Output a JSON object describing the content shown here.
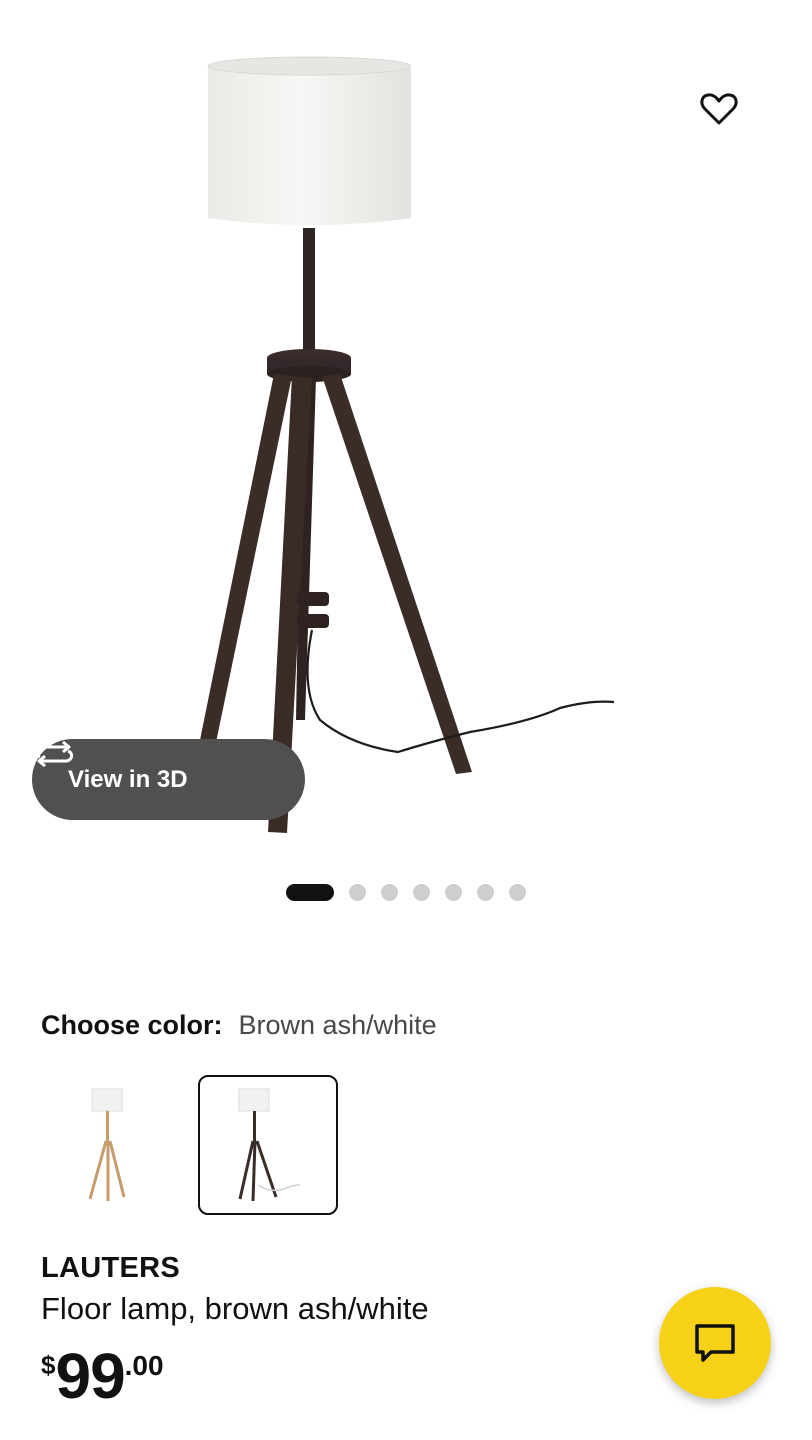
{
  "product": {
    "view_3d_label": "View in 3D",
    "image_count": 7,
    "active_image_index": 0,
    "favorite_icon": "heart-outline-icon",
    "choose_color_label": "Choose color:",
    "selected_color": "Brown ash/white",
    "color_options": [
      {
        "name": "Ash/white",
        "selected": false
      },
      {
        "name": "Brown ash/white",
        "selected": true
      }
    ],
    "name": "LAUTERS",
    "description": "Floor lamp, brown ash/white",
    "price": {
      "currency": "$",
      "integer": "99",
      "decimal": ".00"
    }
  },
  "chat": {
    "icon": "chat-bubble-icon",
    "accent": "#f7d117"
  },
  "colors": {
    "lamp_wood_dark": "#3a2d29",
    "lamp_wood_light": "#c69c6d",
    "shade": "#f1f1ef"
  }
}
